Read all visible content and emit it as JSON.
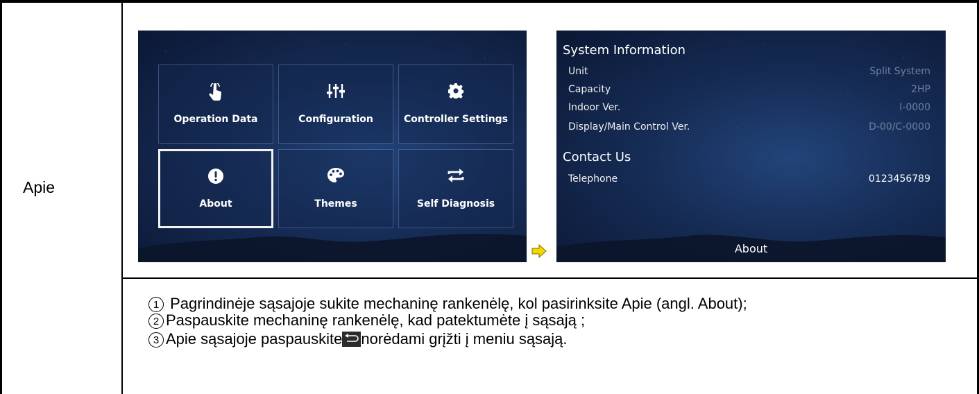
{
  "row_label": "Apie",
  "menu_screen": {
    "tiles": [
      {
        "label": "Operation Data",
        "icon": "hand-pointer-icon",
        "glyph": "☝",
        "selected": false
      },
      {
        "label": "Configuration",
        "icon": "sliders-icon",
        "glyph": "⫲",
        "selected": false
      },
      {
        "label": "Controller Settings",
        "icon": "gear-icon",
        "glyph": "⚙",
        "selected": false
      },
      {
        "label": "About",
        "icon": "exclamation-circle-icon",
        "glyph": "!",
        "selected": true
      },
      {
        "label": "Themes",
        "icon": "palette-icon",
        "glyph": "🎨",
        "selected": false
      },
      {
        "label": "Self Diagnosis",
        "icon": "swap-arrows-icon",
        "glyph": "⇄",
        "selected": false
      }
    ]
  },
  "about_screen": {
    "system_info_title": "System Information",
    "system_info": [
      {
        "label": "Unit",
        "value": "Split System"
      },
      {
        "label": "Capacity",
        "value": "2HP"
      },
      {
        "label": "Indoor Ver.",
        "value": "I-0000"
      },
      {
        "label": "Display/Main Control Ver.",
        "value": "D-00/C-0000"
      }
    ],
    "contact_title": "Contact Us",
    "contact": [
      {
        "label": "Telephone",
        "value": "0123456789"
      }
    ],
    "footer_title": "About"
  },
  "instructions": {
    "step1_num": "1",
    "step1_text": " Pagrindinėje sąsajoje sukite mechaninę rankenėlę, kol pasirinksite Apie (angl. About);",
    "step2_num": "2",
    "step2_text": "Paspauskite mechaninę rankenėlę, kad patektumėte į sąsają ;",
    "step3_num": "3",
    "step3_text_a": "Apie sąsajoje paspauskite",
    "step3_text_b": "norėdami grįžti į meniu sąsają."
  },
  "colors": {
    "screen_bg": "#162c55",
    "arrow_fill": "#f5d800",
    "value_dim": "#6f7f9c"
  }
}
